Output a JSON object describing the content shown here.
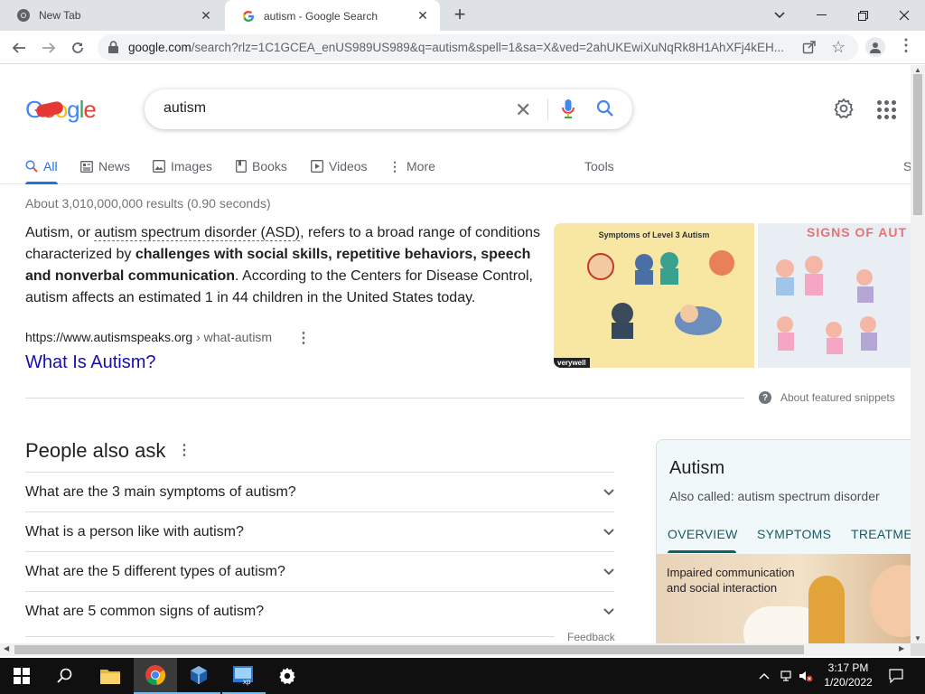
{
  "browser": {
    "tabs": [
      {
        "title": "New Tab",
        "active": false
      },
      {
        "title": "autism - Google Search",
        "active": true
      }
    ],
    "url_host": "google.com",
    "url_rest": "/search?rlz=1C1GCEA_enUS989US989&q=autism&spell=1&sa=X&ved=2ahUKEwiXuNqRk8H1AhXFj4kEH..."
  },
  "google": {
    "logo_text": "Google",
    "query": "autism",
    "tabs": [
      {
        "label": "All",
        "icon": "search-icon"
      },
      {
        "label": "News",
        "icon": "news-icon"
      },
      {
        "label": "Images",
        "icon": "image-icon"
      },
      {
        "label": "Books",
        "icon": "book-icon"
      },
      {
        "label": "Videos",
        "icon": "video-icon"
      },
      {
        "label": "More",
        "icon": "more-vert-icon"
      }
    ],
    "tools_label": "Tools",
    "cut_tab": "S",
    "result_stats": "About 3,010,000,000 results (0.90 seconds)"
  },
  "snippet": {
    "p1": "Autism, or ",
    "link": "autism spectrum disorder (ASD)",
    "p2": ", refers to a broad range of conditions characterized by ",
    "bold": "challenges with social skills, repetitive behaviors, speech and nonverbal communication",
    "p3": ". According to the Centers for Disease Control, autism affects an estimated 1 in 44 children in the United States today.",
    "source_url": "https://www.autismspeaks.org",
    "source_crumb": " › what-autism",
    "title": "What Is Autism?",
    "image1_title": "Symptoms of Level 3 Autism",
    "image1_badge": "verywell",
    "image2_title": "SIGNS OF AUT",
    "about_label": "About featured snippets"
  },
  "people_also_ask": {
    "title": "People also ask",
    "questions": [
      "What are the 3 main symptoms of autism?",
      "What is a person like with autism?",
      "What are the 5 different types of autism?",
      "What are 5 common signs of autism?"
    ],
    "feedback": "Feedback"
  },
  "knowledge_panel": {
    "title": "Autism",
    "also_called": "Also called: autism spectrum disorder",
    "tabs": [
      "OVERVIEW",
      "SYMPTOMS",
      "TREATME"
    ],
    "caption_line1": "Impaired communication",
    "caption_line2": "and social interaction"
  },
  "taskbar": {
    "time": "3:17 PM",
    "date": "1/20/2022",
    "apps": [
      "windows-start-icon",
      "search-icon",
      "file-explorer-icon",
      "chrome-icon",
      "virtualbox-icon",
      "xp-app-icon",
      "settings-icon"
    ]
  },
  "colors": {
    "link": "#1a0dab",
    "accent": "#1a73e8",
    "kp_accent": "#12606b"
  }
}
